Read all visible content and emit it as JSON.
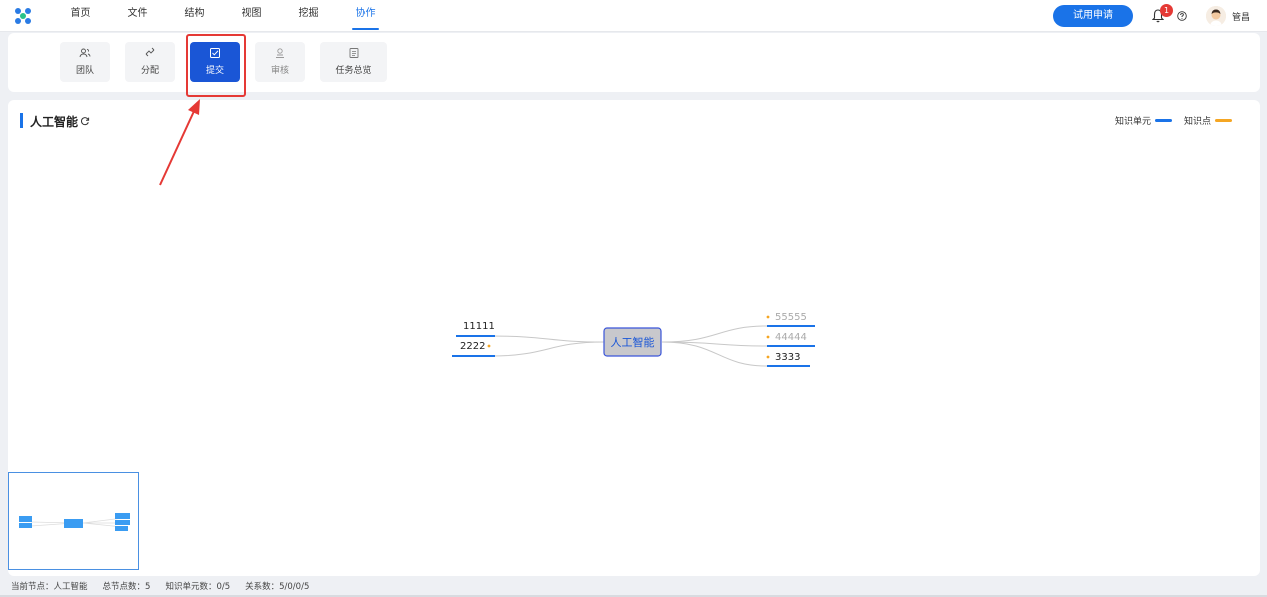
{
  "nav": {
    "items": [
      "首页",
      "文件",
      "结构",
      "视图",
      "挖掘",
      "协作"
    ],
    "active_index": 5
  },
  "header": {
    "trial_label": "试用申请",
    "notification_count": "1",
    "username": "管昌"
  },
  "toolbar": {
    "buttons": [
      {
        "label": "团队",
        "icon": "team-icon"
      },
      {
        "label": "分配",
        "icon": "assign-icon"
      },
      {
        "label": "提交",
        "icon": "submit-icon",
        "active": true
      },
      {
        "label": "审核",
        "icon": "review-icon"
      },
      {
        "label": "任务总览",
        "icon": "task-overview-icon"
      }
    ]
  },
  "main": {
    "title": "人工智能",
    "legend": [
      {
        "label": "知识单元",
        "color": "#1a73e8"
      },
      {
        "label": "知识点",
        "color": "#f5a623"
      }
    ]
  },
  "mindmap": {
    "root": "人工智能",
    "left": [
      "11111",
      "2222"
    ],
    "right": [
      "55555",
      "44444",
      "3333"
    ]
  },
  "statusbar": {
    "current_node": "当前节点：人工智能",
    "total_nodes": "总节点数：5",
    "knowledge_units": "知识单元数：0/5",
    "relations": "关系数：5/0/0/5"
  },
  "colors": {
    "accent": "#1a73e8",
    "active_tool": "#1a56d6",
    "highlight": "#e53935",
    "knowledge_point": "#f5a623"
  }
}
